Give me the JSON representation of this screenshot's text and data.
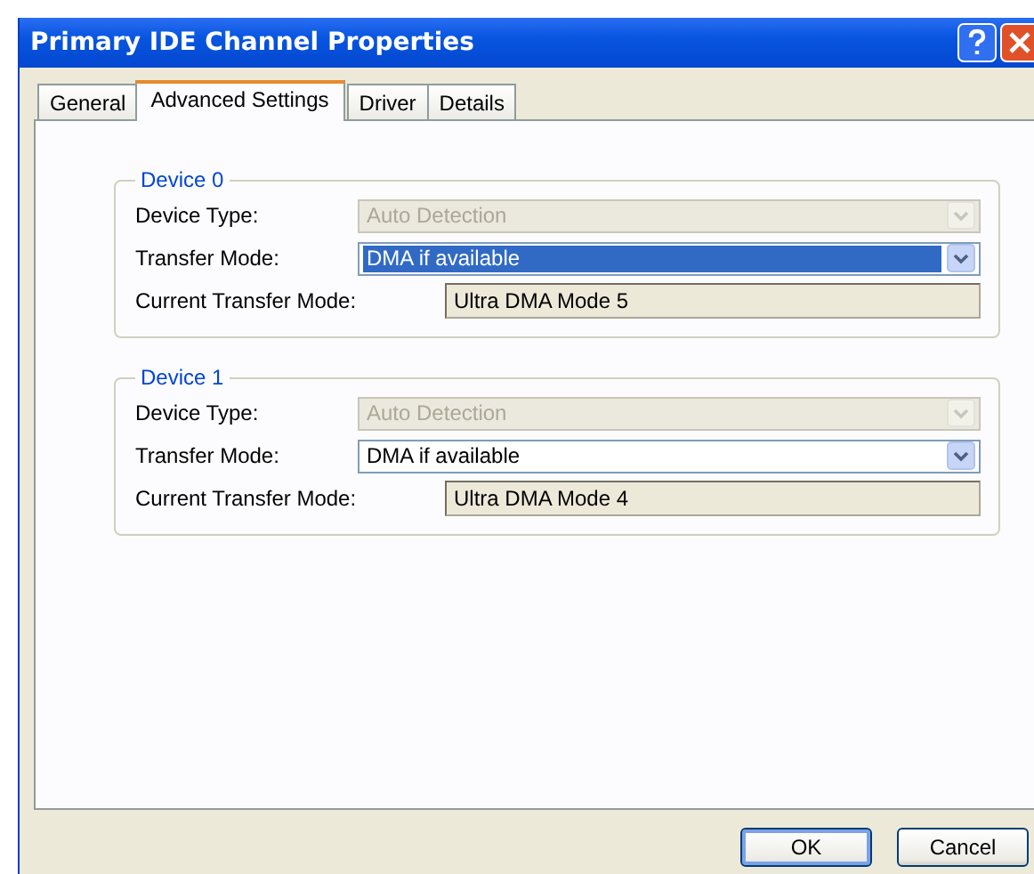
{
  "window": {
    "title": "Primary IDE Channel Properties"
  },
  "tabs": [
    {
      "label": "General",
      "selected": false
    },
    {
      "label": "Advanced Settings",
      "selected": true
    },
    {
      "label": "Driver",
      "selected": false
    },
    {
      "label": "Details",
      "selected": false
    }
  ],
  "devices": [
    {
      "title": "Device 0",
      "device_type": {
        "label": "Device Type:",
        "value": "Auto Detection",
        "disabled": true
      },
      "transfer_mode": {
        "label": "Transfer Mode:",
        "value": "DMA if available",
        "highlighted": true
      },
      "current_mode": {
        "label": "Current Transfer Mode:",
        "value": "Ultra DMA Mode 5"
      }
    },
    {
      "title": "Device 1",
      "device_type": {
        "label": "Device Type:",
        "value": "Auto Detection",
        "disabled": true
      },
      "transfer_mode": {
        "label": "Transfer Mode:",
        "value": "DMA if available",
        "highlighted": false
      },
      "current_mode": {
        "label": "Current Transfer Mode:",
        "value": "Ultra DMA Mode 4"
      }
    }
  ],
  "buttons": [
    "OK",
    "Cancel"
  ]
}
